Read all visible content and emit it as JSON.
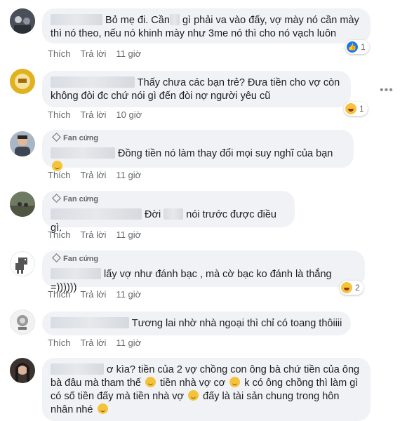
{
  "actions": {
    "like": "Thích",
    "reply": "Trả lời"
  },
  "badge_label": "Fan cứng",
  "comments": [
    {
      "line1": "Bỏ mẹ đi. Cần",
      "line1b": "gì phải va vào đấy, vợ mày nó cần mày",
      "line2": "thì nó theo, nếu nó khinh mày như 3me nó thì cho nó vạch luôn",
      "time": "11 giờ",
      "reaction_count": "1"
    },
    {
      "line1": "Thấy chưa các bạn trẻ? Đưa tiền cho vợ còn",
      "line2": "không đòi đc chứ nói gì đến đòi nợ người yêu cũ",
      "time": "10 giờ",
      "reaction_count": "1"
    },
    {
      "text": "Đồng tiền nó làm thay đổi mọi suy nghĩ của bạn",
      "time": "11 giờ"
    },
    {
      "text_a": "Đời",
      "text_b": "nói trước được điều gì.",
      "time": "11 giờ"
    },
    {
      "text": "lấy vợ như đánh bạc , mà cờ bạc ko đánh là thắng =))))))",
      "time": "11 giờ",
      "reaction_count": "2"
    },
    {
      "text": "Tương lai nhờ nhà ngoại thì chỉ có toang thôiiii",
      "time": "11 giờ"
    },
    {
      "line1": "ơ kìa? tiền của 2 vợ chồng con ông bà chứ tiền của ông",
      "line2a": "bà đâu mà tham thế",
      "line2b": "tiền nhà vợ cơ",
      "line2c": "k có ông chồng thì làm gì",
      "line3a": "có số tiền đấy mà tiền nhà vợ",
      "line3b": "đấy là tài sản chung trong hôn",
      "line4": "nhân nhé"
    }
  ]
}
